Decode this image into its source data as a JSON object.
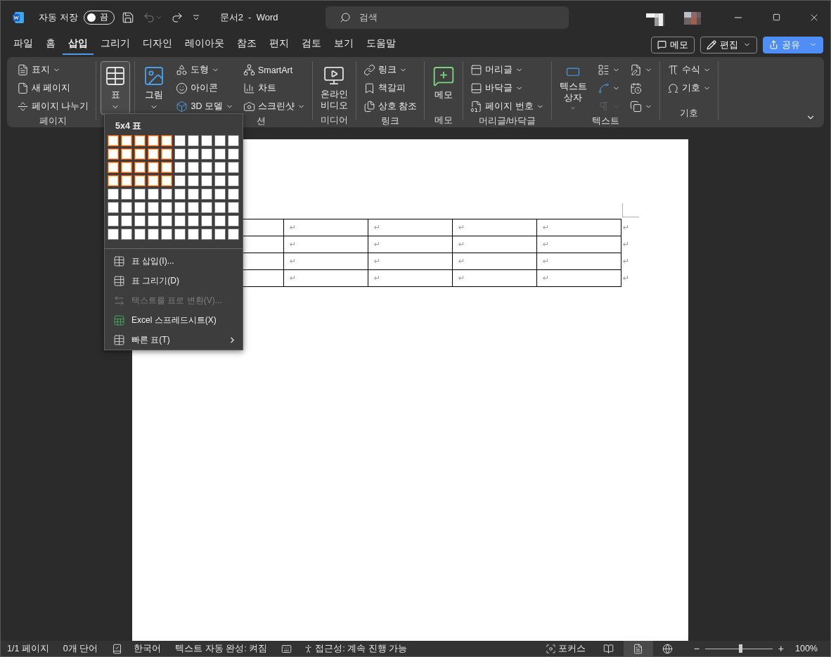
{
  "titlebar": {
    "autosave_label": "자동 저장",
    "autosave": {
      "on": false,
      "label": "끔"
    },
    "undo_disabled": true,
    "title": "문서2  -  Word",
    "search": {
      "placeholder": "검색"
    }
  },
  "tabs": [
    {
      "label": "파일",
      "selected": false
    },
    {
      "label": "홈",
      "selected": false
    },
    {
      "label": "삽입",
      "selected": true
    },
    {
      "label": "그리기",
      "selected": false
    },
    {
      "label": "디자인",
      "selected": false
    },
    {
      "label": "레이아웃",
      "selected": false
    },
    {
      "label": "참조",
      "selected": false
    },
    {
      "label": "편지",
      "selected": false
    },
    {
      "label": "검토",
      "selected": false
    },
    {
      "label": "보기",
      "selected": false
    },
    {
      "label": "도움말",
      "selected": false
    }
  ],
  "tab_actions": [
    {
      "kind": "outline",
      "label": "메모"
    },
    {
      "kind": "menu",
      "label": "편집"
    },
    {
      "kind": "primary",
      "label": "공유"
    }
  ],
  "ribbon": {
    "groups": [
      {
        "label": "페이지",
        "columns": [
          {
            "kind": "stack",
            "items": [
              {
                "label": "표지",
                "dropdown": true
              },
              {
                "label": "새 페이지",
                "dropdown": false
              },
              {
                "label": "페이지 나누기",
                "dropdown": false
              }
            ]
          }
        ]
      },
      {
        "columns": [
          {
            "kind": "large",
            "items": [
              {
                "label": "표",
                "dropdown": true,
                "selected": true
              }
            ]
          }
        ]
      },
      {
        "label": "션",
        "columns": [
          {
            "kind": "large",
            "items": [
              {
                "label": "그림",
                "dropdown": true,
                "selected": false
              }
            ]
          },
          {
            "kind": "stack",
            "items": [
              {
                "label": "도형",
                "dropdown": true
              },
              {
                "label": "아이콘",
                "dropdown": false
              },
              {
                "label": "3D 모델",
                "dropdown": true
              }
            ]
          },
          {
            "kind": "stack",
            "items": [
              {
                "label": "SmartArt",
                "dropdown": false
              },
              {
                "label": "차트",
                "dropdown": false
              },
              {
                "label": "스크린샷",
                "dropdown": true
              }
            ]
          }
        ]
      },
      {
        "label": "미디어",
        "columns": [
          {
            "kind": "large",
            "items": [
              {
                "label": "온라인\n비디오",
                "dropdown": false,
                "selected": false
              }
            ]
          }
        ]
      },
      {
        "label": "링크",
        "columns": [
          {
            "kind": "stack",
            "items": [
              {
                "label": "링크",
                "dropdown": true
              },
              {
                "label": "책갈피",
                "dropdown": false
              },
              {
                "label": "상호 참조",
                "dropdown": false
              }
            ]
          }
        ]
      },
      {
        "label": "메모",
        "columns": [
          {
            "kind": "large",
            "items": [
              {
                "label": "메모",
                "dropdown": false,
                "selected": false
              }
            ]
          }
        ]
      },
      {
        "label": "머리글/바닥글",
        "columns": [
          {
            "kind": "stack",
            "items": [
              {
                "label": "머리글",
                "dropdown": true
              },
              {
                "label": "바닥글",
                "dropdown": true
              },
              {
                "label": "페이지 번호",
                "dropdown": true
              }
            ]
          }
        ]
      },
      {
        "label": "텍스트",
        "columns": [
          {
            "kind": "large",
            "items": [
              {
                "label": "텍스트\n상자",
                "dropdown": true,
                "selected": false
              }
            ]
          },
          {
            "kind": "stack",
            "items": [
              {
                "dropdown": true,
                "disabled": false
              },
              {
                "dropdown": true,
                "disabled": false
              },
              {
                "dropdown": true,
                "disabled": true
              }
            ]
          },
          {
            "kind": "stack",
            "items": [
              {
                "dropdown": true
              },
              {
                "dropdown": false
              },
              {
                "dropdown": true
              }
            ]
          }
        ]
      },
      {
        "label": "기호",
        "columns": [
          {
            "kind": "stack",
            "items": [
              {
                "label": "수식",
                "dropdown": true
              },
              {
                "label": "기호",
                "dropdown": true
              }
            ]
          }
        ]
      }
    ]
  },
  "document": {
    "table": {
      "rows": [
        {
          "cells": [
            {},
            {
              "mark": "↵"
            },
            {
              "mark": "↵"
            },
            {
              "mark": "↵"
            },
            {
              "mark": "↵"
            }
          ],
          "row_end": "↵"
        },
        {
          "cells": [
            {},
            {
              "mark": "↵"
            },
            {
              "mark": "↵"
            },
            {
              "mark": "↵"
            },
            {
              "mark": "↵"
            }
          ],
          "row_end": "↵"
        },
        {
          "cells": [
            {},
            {
              "mark": "↵"
            },
            {
              "mark": "↵"
            },
            {
              "mark": "↵"
            },
            {
              "mark": "↵"
            }
          ],
          "row_end": "↵"
        },
        {
          "cells": [
            {},
            {
              "mark": "↵"
            },
            {
              "mark": "↵"
            },
            {
              "mark": "↵"
            },
            {
              "mark": "↵"
            }
          ],
          "row_end": "↵"
        }
      ]
    }
  },
  "table_menu": {
    "title": "5x4 표",
    "grid": [
      [
        true,
        true,
        true,
        true,
        true,
        false,
        false,
        false,
        false,
        false
      ],
      [
        true,
        true,
        true,
        true,
        true,
        false,
        false,
        false,
        false,
        false
      ],
      [
        true,
        true,
        true,
        true,
        true,
        false,
        false,
        false,
        false,
        false
      ],
      [
        true,
        true,
        true,
        true,
        true,
        false,
        false,
        false,
        false,
        false
      ],
      [
        false,
        false,
        false,
        false,
        false,
        false,
        false,
        false,
        false,
        false
      ],
      [
        false,
        false,
        false,
        false,
        false,
        false,
        false,
        false,
        false,
        false
      ],
      [
        false,
        false,
        false,
        false,
        false,
        false,
        false,
        false,
        false,
        false
      ],
      [
        false,
        false,
        false,
        false,
        false,
        false,
        false,
        false,
        false,
        false
      ]
    ],
    "items": [
      {
        "label": "표 삽입(I)...",
        "disabled": false,
        "submenu": false
      },
      {
        "label": "표 그리기(D)",
        "disabled": false,
        "submenu": false
      },
      {
        "label": "텍스트를 표로 변환(V)...",
        "disabled": true,
        "submenu": false
      },
      {
        "label": "Excel 스프레드시트(X)",
        "disabled": false,
        "submenu": false
      },
      {
        "label": "빠른 표(T)",
        "disabled": false,
        "submenu": true
      }
    ]
  },
  "status_bar": {
    "page": "1/1 페이지",
    "words": "0개 단어",
    "language": "한국어",
    "predictions": "텍스트 자동 완성: 켜짐",
    "accessibility": "접근성: 계속 진행 가능",
    "focus": "포커스",
    "views": [
      {
        "selected": false
      },
      {
        "selected": true
      },
      {
        "selected": false
      }
    ],
    "zoom_out": "−",
    "zoom": {
      "level": 0.52
    },
    "zoom_in": "+",
    "zoom_percent": "100%"
  }
}
